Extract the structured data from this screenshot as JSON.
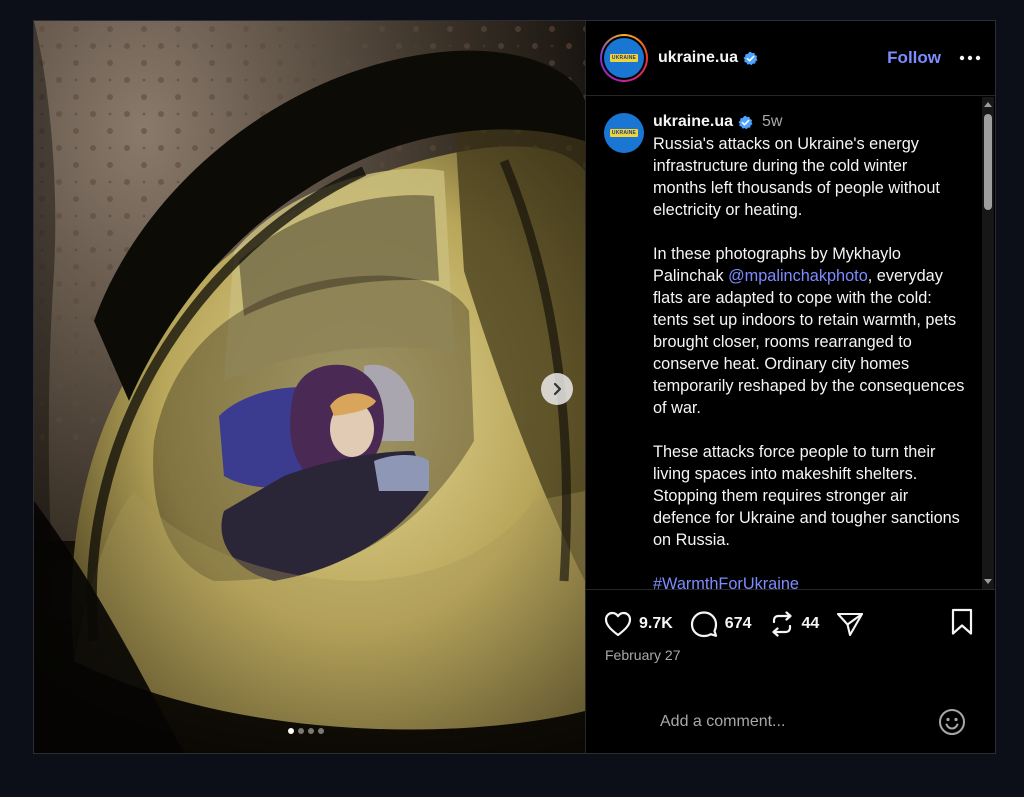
{
  "post": {
    "username": "ukraine.ua",
    "avatar_text": "UKRAINE",
    "verified": true,
    "follow_label": "Follow",
    "more_icon": "more-dots-icon",
    "time_ago": "5w",
    "caption": {
      "p1": "Russia's attacks on Ukraine's energy infrastructure during the cold winter months left thousands of people without electricity or heating.",
      "p2_before": "In these photographs by Mykhaylo Palinchak ",
      "p2_mention": "@mpalinchakphoto",
      "p2_after": ", everyday flats are adapted to cope with the cold: tents set up indoors to retain warmth, pets brought closer, rooms rearranged to conserve heat. Ordinary city homes temporarily reshaped by the consequences of war.",
      "p3": "These attacks force people to turn their living spaces into makeshift shelters. Stopping them requires stronger air defence for Ukraine and tougher sanctions on Russia.",
      "hashtag": "#WarmthForUkraine"
    },
    "likes": "9.7K",
    "comments": "674",
    "reposts": "44",
    "date": "February 27",
    "comment_placeholder": "Add a comment...",
    "carousel": {
      "total": 4,
      "active": 1
    }
  },
  "colors": {
    "accent": "#7d8cff",
    "verified": "#4da3ff",
    "avatar_blue": "#1976d2"
  }
}
